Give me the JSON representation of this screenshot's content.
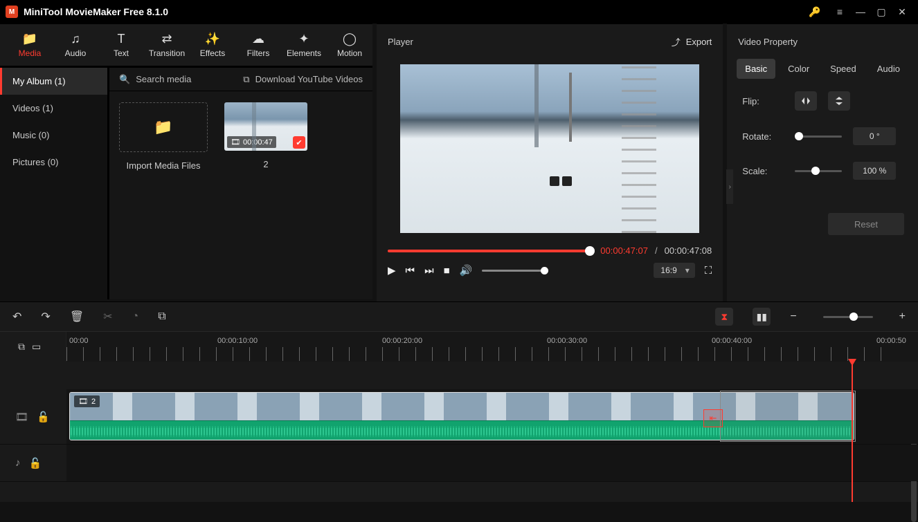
{
  "app": {
    "title": "MiniTool MovieMaker Free 8.1.0"
  },
  "tabs": [
    {
      "label": "Media",
      "icon": "📁"
    },
    {
      "label": "Audio",
      "icon": "♫"
    },
    {
      "label": "Text",
      "icon": "T"
    },
    {
      "label": "Transition",
      "icon": "⇄"
    },
    {
      "label": "Effects",
      "icon": "✨"
    },
    {
      "label": "Filters",
      "icon": "☁"
    },
    {
      "label": "Elements",
      "icon": "✦"
    },
    {
      "label": "Motion",
      "icon": "◯"
    }
  ],
  "library": {
    "sidebar": [
      {
        "label": "My Album (1)",
        "active": true
      },
      {
        "label": "Videos (1)"
      },
      {
        "label": "Music (0)"
      },
      {
        "label": "Pictures (0)"
      }
    ],
    "search_placeholder": "Search media",
    "download_label": "Download YouTube Videos",
    "import_label": "Import Media Files",
    "thumb": {
      "duration": "00:00:47",
      "caption": "2"
    }
  },
  "player": {
    "title": "Player",
    "export_label": "Export",
    "current_time": "00:00:47:07",
    "total_time": "00:00:47:08",
    "aspect": "16:9"
  },
  "props": {
    "title": "Video Property",
    "tabs": [
      "Basic",
      "Color",
      "Speed",
      "Audio"
    ],
    "flip_label": "Flip:",
    "rotate_label": "Rotate:",
    "rotate_value": "0 °",
    "scale_label": "Scale:",
    "scale_value": "100 %",
    "reset": "Reset"
  },
  "timeline": {
    "marks": [
      "00:00",
      "00:00:10:00",
      "00:00:20:00",
      "00:00:30:00",
      "00:00:40:00",
      "00:00:50"
    ],
    "clip_badge": "2"
  }
}
